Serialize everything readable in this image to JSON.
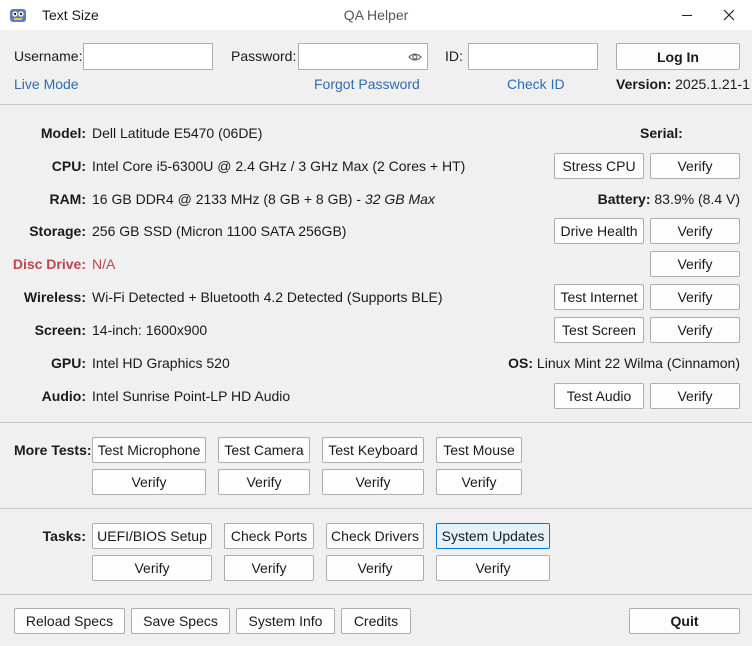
{
  "window": {
    "title": "Text Size",
    "app_name": "QA Helper",
    "minimize_icon": "minimize-icon",
    "close_icon": "close-icon"
  },
  "login": {
    "username_label": "Username:",
    "username_value": "",
    "password_label": "Password:",
    "password_value": "",
    "id_label": "ID:",
    "id_value": "",
    "login_button": "Log In",
    "live_mode_link": "Live Mode",
    "forgot_password_link": "Forgot Password",
    "check_id_link": "Check ID",
    "version_label": "Version:",
    "version_value": "2025.1.21-1"
  },
  "specs": {
    "model_label": "Model:",
    "model_value": "Dell Latitude E5470 (06DE)",
    "serial_label": "Serial:",
    "serial_value": "",
    "cpu_label": "CPU:",
    "cpu_value": "Intel Core i5-6300U @ 2.4 GHz / 3 GHz Max (2 Cores + HT)",
    "ram_label": "RAM:",
    "ram_value": "16 GB DDR4 @ 2133 MHz (8 GB + 8 GB) - ",
    "ram_max": "32 GB Max",
    "battery_label": "Battery:",
    "battery_value": "83.9% (8.4 V)",
    "storage_label": "Storage:",
    "storage_value": "256 GB SSD (Micron 1100 SATA 256GB)",
    "disc_label": "Disc Drive:",
    "disc_value": "N/A",
    "wireless_label": "Wireless:",
    "wireless_value": "Wi-Fi Detected + Bluetooth 4.2 Detected (Supports BLE)",
    "screen_label": "Screen:",
    "screen_value": "14-inch: 1600x900",
    "gpu_label": "GPU:",
    "gpu_value": "Intel HD Graphics 520",
    "os_label": "OS:",
    "os_value": "Linux Mint 22 Wilma (Cinnamon)",
    "audio_label": "Audio:",
    "audio_value": "Intel Sunrise Point-LP HD Audio"
  },
  "buttons": {
    "stress_cpu": "Stress CPU",
    "drive_health": "Drive Health",
    "test_internet": "Test Internet",
    "test_screen": "Test Screen",
    "test_audio": "Test Audio",
    "verify": "Verify"
  },
  "more_tests": {
    "label": "More Tests:",
    "test_microphone": "Test Microphone",
    "test_camera": "Test Camera",
    "test_keyboard": "Test Keyboard",
    "test_mouse": "Test Mouse"
  },
  "tasks": {
    "label": "Tasks:",
    "uefi": "UEFI/BIOS Setup",
    "check_ports": "Check Ports",
    "check_drivers": "Check Drivers",
    "system_updates": "System Updates"
  },
  "footer": {
    "reload_specs": "Reload Specs",
    "save_specs": "Save Specs",
    "system_info": "System Info",
    "credits": "Credits",
    "quit": "Quit"
  }
}
